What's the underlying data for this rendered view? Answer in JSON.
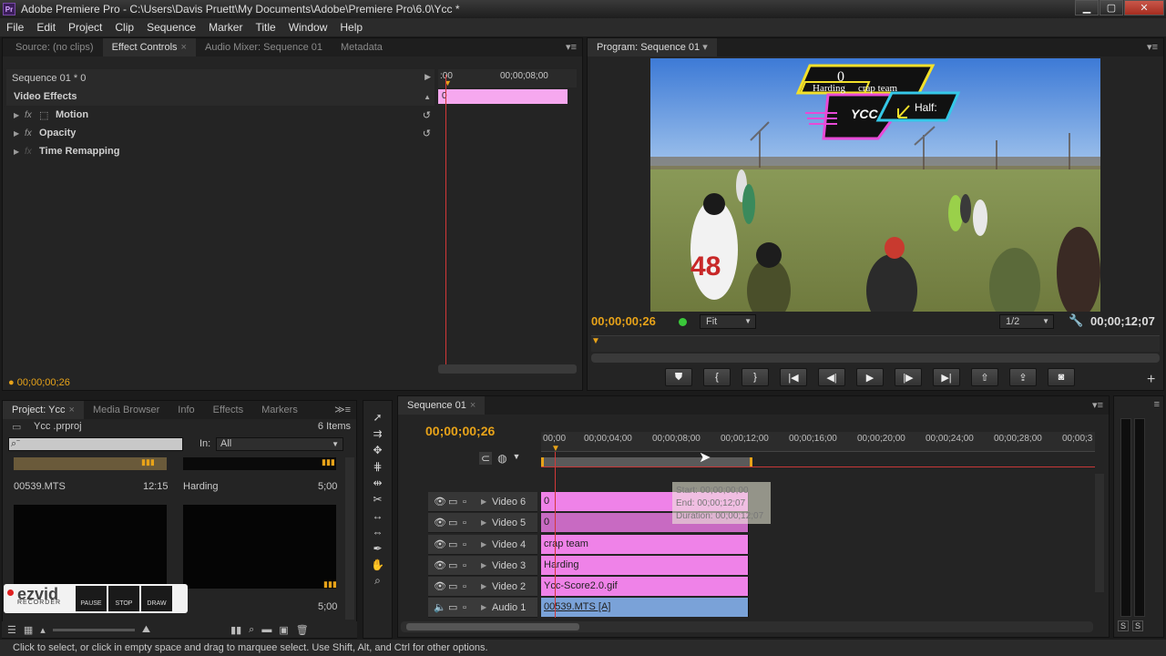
{
  "window": {
    "title": "Adobe Premiere Pro - C:\\Users\\Davis Pruett\\My Documents\\Adobe\\Premiere Pro\\6.0\\Ycc *",
    "logo": "Pr"
  },
  "menu": [
    "File",
    "Edit",
    "Project",
    "Clip",
    "Sequence",
    "Marker",
    "Title",
    "Window",
    "Help"
  ],
  "source_panel": {
    "tabs": [
      "Source: (no clips)",
      "Effect Controls",
      "Audio Mixer: Sequence 01",
      "Metadata"
    ],
    "active_tab": 1,
    "sequence_label": "Sequence 01 * 0",
    "ruler": {
      "start": ":00",
      "mid": "00;00;08;00"
    },
    "clip_label": "0",
    "section": "Video Effects",
    "effects": [
      {
        "name": "Motion"
      },
      {
        "name": "Opacity"
      },
      {
        "name": "Time Remapping"
      }
    ],
    "timecode": "00;00;00;26"
  },
  "program_panel": {
    "tab": "Program: Sequence 01",
    "timecode_current": "00;00;00;26",
    "timecode_duration": "00;00;12;07",
    "fit": "Fit",
    "resolution": "1/2",
    "overlay": {
      "score": "0",
      "team1": "Harding",
      "team2": "crap team",
      "half": "Half:",
      "logo": "YCC"
    },
    "jersey_number": "48"
  },
  "project_panel": {
    "tabs": [
      "Project: Ycc",
      "Media Browser",
      "Info",
      "Effects",
      "Markers"
    ],
    "file": "Ycc .prproj",
    "items_count": "6 Items",
    "in_label": "In:",
    "in_value": "All",
    "items": [
      {
        "name": "00539.MTS",
        "duration": "12:15"
      },
      {
        "name": "Harding",
        "duration": "5;00"
      },
      {
        "name": "",
        "duration": ""
      },
      {
        "name": "",
        "duration": "5;00"
      }
    ]
  },
  "ezvid": {
    "brand": "ezvid",
    "sub": "RECORDER",
    "pause": "PAUSE",
    "stop": "STOP",
    "draw": "DRAW"
  },
  "timeline": {
    "tab": "Sequence 01",
    "timecode": "00;00;00;26",
    "ruler": [
      "00;00",
      "00;00;04;00",
      "00;00;08;00",
      "00;00;12;00",
      "00;00;16;00",
      "00;00;20;00",
      "00;00;24;00",
      "00;00;28;00",
      "00;00;3"
    ],
    "tracks": [
      {
        "name": "Video 6",
        "clip": "0"
      },
      {
        "name": "Video 5",
        "clip": "0"
      },
      {
        "name": "Video 4",
        "clip": "crap team"
      },
      {
        "name": "Video 3",
        "clip": "Harding"
      },
      {
        "name": "Video 2",
        "clip": "Ycc-Score2.0.gif"
      },
      {
        "name": "Audio 1",
        "clip": "00539.MTS [A]"
      }
    ],
    "tooltip": {
      "start": "Start: 00;00;00;00",
      "end": "End: 00;00;12;07",
      "duration": "Duration: 00;00;12;07"
    }
  },
  "status_bar": "Click to select, or click in empty space and drag to marquee select. Use Shift, Alt, and Ctrl for other options.",
  "colors": {
    "accent": "#e8a319",
    "clip_pink": "#ef82e8",
    "clip_audio": "#7aa2d8"
  }
}
